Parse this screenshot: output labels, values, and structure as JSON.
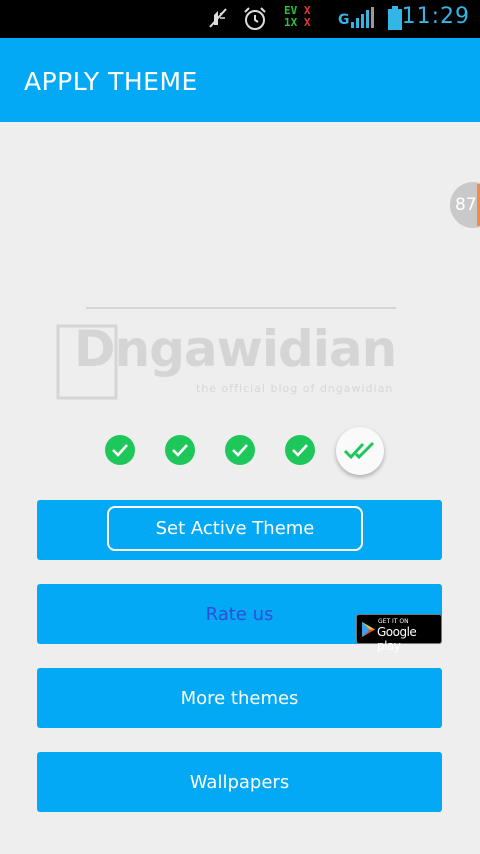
{
  "status_bar": {
    "time": "11:29",
    "ev_line1": "EV",
    "ev_line2": "1X",
    "x_mark": "X",
    "network": "G",
    "icons": [
      "mute-icon",
      "alarm-icon",
      "signal-icon",
      "battery-icon"
    ]
  },
  "appbar": {
    "title": "APPLY THEME"
  },
  "side_badge": {
    "value": "87"
  },
  "watermark": {
    "name": "Dngawidian",
    "tagline": "the official blog of dngawidian"
  },
  "steps": {
    "completed": 4,
    "total": 5
  },
  "buttons": {
    "set_active": "Set Active Theme",
    "rate": "Rate us",
    "more": "More themes",
    "wallpapers": "Wallpapers"
  },
  "google_play": {
    "small": "GET IT ON",
    "big": "Google play"
  },
  "colors": {
    "primary": "#03a9f4",
    "check_green": "#1ec75a",
    "background": "#eeeeee",
    "rate_text": "#2f4fd6"
  }
}
